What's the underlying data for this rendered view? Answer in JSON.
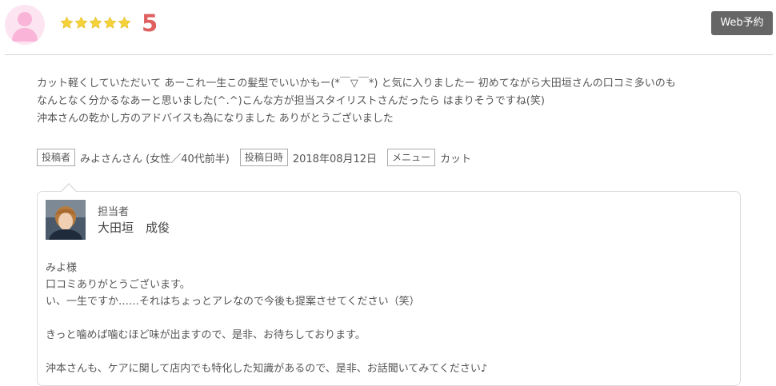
{
  "header": {
    "rating_value": "5",
    "star_count": 5,
    "star_color": "#f5d23a",
    "web_reserve_label": "Web予約"
  },
  "review": {
    "lines": [
      "カット軽くしていただいて あーこれ一生この髪型でいいかもー(*￣▽￣*) と気に入りましたー 初めてながら大田垣さんの口コミ多いのも",
      "なんとなく分かるなあーと思いました(^.^)こんな方が担当スタイリストさんだったら はまりそうですね(笑)",
      "沖本さんの乾かし方のアドバイスも為になりました ありがとうございました"
    ]
  },
  "meta": {
    "poster_label": "投稿者",
    "poster_value": "みよさんさん (女性／40代前半)",
    "date_label": "投稿日時",
    "date_value": "2018年08月12日",
    "menu_label": "メニュー",
    "menu_value": "カット"
  },
  "reply": {
    "staff_label": "担当者",
    "staff_name": "大田垣　成俊",
    "lines": [
      "みよ様",
      "口コミありがとうございます。",
      "い、一生ですか……それはちょっとアレなので今後も提案させてください（笑）",
      "",
      "きっと噛めば噛むほど味が出ますので、是非、お待ちしております。",
      "",
      "沖本さんも、ケアに関して店内でも特化した知識があるので、是非、お話聞いてみてください♪"
    ]
  }
}
